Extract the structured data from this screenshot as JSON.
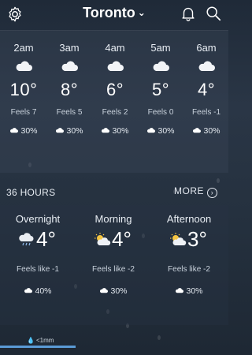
{
  "header": {
    "city": "Toronto",
    "chevron": "⌄",
    "icons": {
      "settings": "gear-icon",
      "alerts": "bell-icon",
      "search": "search-icon"
    }
  },
  "hourly": [
    {
      "time": "2am",
      "temp": "10°",
      "feels": "Feels 7",
      "precip": "30%",
      "icon": "cloud-icon"
    },
    {
      "time": "3am",
      "temp": "8°",
      "feels": "Feels 5",
      "precip": "30%",
      "icon": "cloud-icon"
    },
    {
      "time": "4am",
      "temp": "6°",
      "feels": "Feels 2",
      "precip": "30%",
      "icon": "cloud-icon"
    },
    {
      "time": "5am",
      "temp": "5°",
      "feels": "Feels 0",
      "precip": "30%",
      "icon": "cloud-icon"
    },
    {
      "time": "6am",
      "temp": "4°",
      "feels": "Feels -1",
      "precip": "30%",
      "icon": "cloud-icon"
    }
  ],
  "more_label": "MORE",
  "section_36h": "36 HOURS",
  "periods": [
    {
      "name": "Overnight",
      "temp": "4°",
      "feels": "Feels like -1",
      "precip": "40%",
      "icon": "cloud-moon-rain-icon"
    },
    {
      "name": "Morning",
      "temp": "4°",
      "feels": "Feels like -2",
      "precip": "30%",
      "icon": "sun-cloud-icon"
    },
    {
      "name": "Afternoon",
      "temp": "3°",
      "feels": "Feels like -2",
      "precip": "30%",
      "icon": "sun-cloud-icon"
    }
  ],
  "rain": {
    "label": "<1mm",
    "fill_fraction": 0.33
  },
  "colors": {
    "accent": "#5a9bd6"
  }
}
